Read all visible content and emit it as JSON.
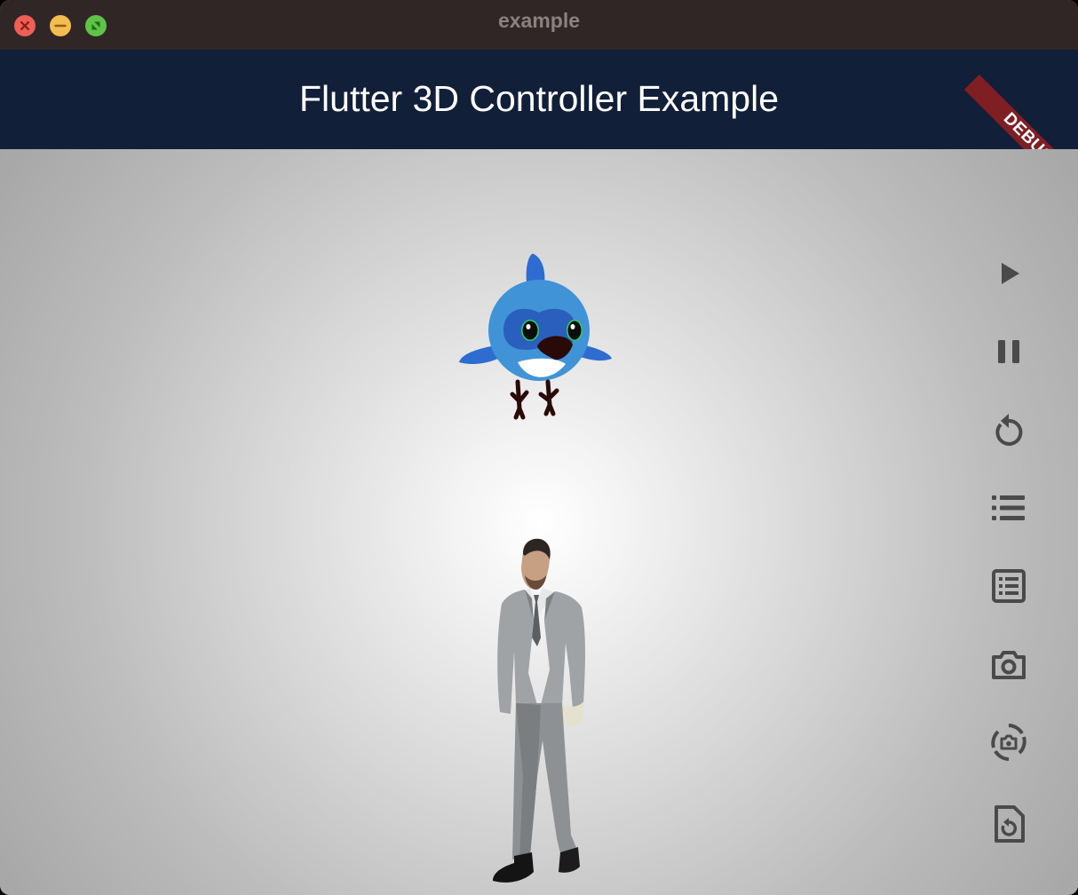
{
  "window": {
    "title": "example"
  },
  "app_bar": {
    "title": "Flutter 3D Controller Example",
    "debug_banner": "DEBUG"
  },
  "colors": {
    "app_bar_bg": "#111f38",
    "title_bar_bg": "#302625",
    "debug_banner_bg": "#7f1f24",
    "icon_color": "#4a4a4a"
  },
  "viewer": {
    "models": [
      "bird-model",
      "man-model"
    ]
  },
  "controls": [
    {
      "name": "play-icon",
      "action": "play animation"
    },
    {
      "name": "pause-icon",
      "action": "pause animation"
    },
    {
      "name": "replay-icon",
      "action": "reset animation"
    },
    {
      "name": "list-icon",
      "action": "available animations"
    },
    {
      "name": "list-alt-icon",
      "action": "available textures"
    },
    {
      "name": "camera-icon",
      "action": "set camera orbit"
    },
    {
      "name": "camera-rotate-icon",
      "action": "reset camera orbit"
    },
    {
      "name": "file-restore-icon",
      "action": "reset model"
    }
  ]
}
